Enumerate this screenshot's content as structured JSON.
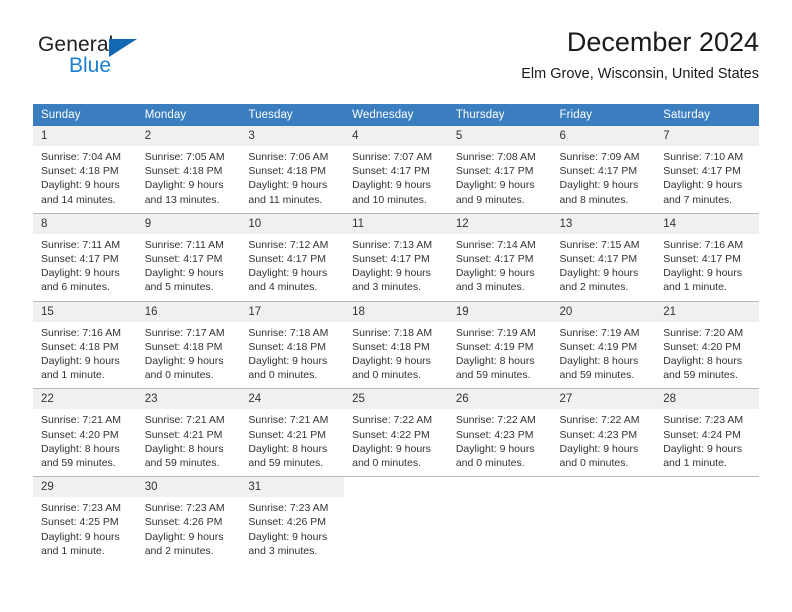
{
  "logo": {
    "text_primary": "General",
    "text_secondary": "Blue",
    "primary_color": "#231f20",
    "secondary_color": "#1a7fd4",
    "triangle_color": "#1268b3"
  },
  "header": {
    "title": "December 2024",
    "subtitle": "Elm Grove, Wisconsin, United States"
  },
  "theme": {
    "header_row_bg": "#3a7ec0",
    "header_row_text": "#ffffff",
    "daynum_bg": "#f0f0f0",
    "cell_border": "#b9b9b9"
  },
  "weekday_headers": [
    "Sunday",
    "Monday",
    "Tuesday",
    "Wednesday",
    "Thursday",
    "Friday",
    "Saturday"
  ],
  "weeks": [
    [
      {
        "day": "1",
        "sunrise": "Sunrise: 7:04 AM",
        "sunset": "Sunset: 4:18 PM",
        "daylight_line1": "Daylight: 9 hours",
        "daylight_line2": "and 14 minutes."
      },
      {
        "day": "2",
        "sunrise": "Sunrise: 7:05 AM",
        "sunset": "Sunset: 4:18 PM",
        "daylight_line1": "Daylight: 9 hours",
        "daylight_line2": "and 13 minutes."
      },
      {
        "day": "3",
        "sunrise": "Sunrise: 7:06 AM",
        "sunset": "Sunset: 4:18 PM",
        "daylight_line1": "Daylight: 9 hours",
        "daylight_line2": "and 11 minutes."
      },
      {
        "day": "4",
        "sunrise": "Sunrise: 7:07 AM",
        "sunset": "Sunset: 4:17 PM",
        "daylight_line1": "Daylight: 9 hours",
        "daylight_line2": "and 10 minutes."
      },
      {
        "day": "5",
        "sunrise": "Sunrise: 7:08 AM",
        "sunset": "Sunset: 4:17 PM",
        "daylight_line1": "Daylight: 9 hours",
        "daylight_line2": "and 9 minutes."
      },
      {
        "day": "6",
        "sunrise": "Sunrise: 7:09 AM",
        "sunset": "Sunset: 4:17 PM",
        "daylight_line1": "Daylight: 9 hours",
        "daylight_line2": "and 8 minutes."
      },
      {
        "day": "7",
        "sunrise": "Sunrise: 7:10 AM",
        "sunset": "Sunset: 4:17 PM",
        "daylight_line1": "Daylight: 9 hours",
        "daylight_line2": "and 7 minutes."
      }
    ],
    [
      {
        "day": "8",
        "sunrise": "Sunrise: 7:11 AM",
        "sunset": "Sunset: 4:17 PM",
        "daylight_line1": "Daylight: 9 hours",
        "daylight_line2": "and 6 minutes."
      },
      {
        "day": "9",
        "sunrise": "Sunrise: 7:11 AM",
        "sunset": "Sunset: 4:17 PM",
        "daylight_line1": "Daylight: 9 hours",
        "daylight_line2": "and 5 minutes."
      },
      {
        "day": "10",
        "sunrise": "Sunrise: 7:12 AM",
        "sunset": "Sunset: 4:17 PM",
        "daylight_line1": "Daylight: 9 hours",
        "daylight_line2": "and 4 minutes."
      },
      {
        "day": "11",
        "sunrise": "Sunrise: 7:13 AM",
        "sunset": "Sunset: 4:17 PM",
        "daylight_line1": "Daylight: 9 hours",
        "daylight_line2": "and 3 minutes."
      },
      {
        "day": "12",
        "sunrise": "Sunrise: 7:14 AM",
        "sunset": "Sunset: 4:17 PM",
        "daylight_line1": "Daylight: 9 hours",
        "daylight_line2": "and 3 minutes."
      },
      {
        "day": "13",
        "sunrise": "Sunrise: 7:15 AM",
        "sunset": "Sunset: 4:17 PM",
        "daylight_line1": "Daylight: 9 hours",
        "daylight_line2": "and 2 minutes."
      },
      {
        "day": "14",
        "sunrise": "Sunrise: 7:16 AM",
        "sunset": "Sunset: 4:17 PM",
        "daylight_line1": "Daylight: 9 hours",
        "daylight_line2": "and 1 minute."
      }
    ],
    [
      {
        "day": "15",
        "sunrise": "Sunrise: 7:16 AM",
        "sunset": "Sunset: 4:18 PM",
        "daylight_line1": "Daylight: 9 hours",
        "daylight_line2": "and 1 minute."
      },
      {
        "day": "16",
        "sunrise": "Sunrise: 7:17 AM",
        "sunset": "Sunset: 4:18 PM",
        "daylight_line1": "Daylight: 9 hours",
        "daylight_line2": "and 0 minutes."
      },
      {
        "day": "17",
        "sunrise": "Sunrise: 7:18 AM",
        "sunset": "Sunset: 4:18 PM",
        "daylight_line1": "Daylight: 9 hours",
        "daylight_line2": "and 0 minutes."
      },
      {
        "day": "18",
        "sunrise": "Sunrise: 7:18 AM",
        "sunset": "Sunset: 4:18 PM",
        "daylight_line1": "Daylight: 9 hours",
        "daylight_line2": "and 0 minutes."
      },
      {
        "day": "19",
        "sunrise": "Sunrise: 7:19 AM",
        "sunset": "Sunset: 4:19 PM",
        "daylight_line1": "Daylight: 8 hours",
        "daylight_line2": "and 59 minutes."
      },
      {
        "day": "20",
        "sunrise": "Sunrise: 7:19 AM",
        "sunset": "Sunset: 4:19 PM",
        "daylight_line1": "Daylight: 8 hours",
        "daylight_line2": "and 59 minutes."
      },
      {
        "day": "21",
        "sunrise": "Sunrise: 7:20 AM",
        "sunset": "Sunset: 4:20 PM",
        "daylight_line1": "Daylight: 8 hours",
        "daylight_line2": "and 59 minutes."
      }
    ],
    [
      {
        "day": "22",
        "sunrise": "Sunrise: 7:21 AM",
        "sunset": "Sunset: 4:20 PM",
        "daylight_line1": "Daylight: 8 hours",
        "daylight_line2": "and 59 minutes."
      },
      {
        "day": "23",
        "sunrise": "Sunrise: 7:21 AM",
        "sunset": "Sunset: 4:21 PM",
        "daylight_line1": "Daylight: 8 hours",
        "daylight_line2": "and 59 minutes."
      },
      {
        "day": "24",
        "sunrise": "Sunrise: 7:21 AM",
        "sunset": "Sunset: 4:21 PM",
        "daylight_line1": "Daylight: 8 hours",
        "daylight_line2": "and 59 minutes."
      },
      {
        "day": "25",
        "sunrise": "Sunrise: 7:22 AM",
        "sunset": "Sunset: 4:22 PM",
        "daylight_line1": "Daylight: 9 hours",
        "daylight_line2": "and 0 minutes."
      },
      {
        "day": "26",
        "sunrise": "Sunrise: 7:22 AM",
        "sunset": "Sunset: 4:23 PM",
        "daylight_line1": "Daylight: 9 hours",
        "daylight_line2": "and 0 minutes."
      },
      {
        "day": "27",
        "sunrise": "Sunrise: 7:22 AM",
        "sunset": "Sunset: 4:23 PM",
        "daylight_line1": "Daylight: 9 hours",
        "daylight_line2": "and 0 minutes."
      },
      {
        "day": "28",
        "sunrise": "Sunrise: 7:23 AM",
        "sunset": "Sunset: 4:24 PM",
        "daylight_line1": "Daylight: 9 hours",
        "daylight_line2": "and 1 minute."
      }
    ],
    [
      {
        "day": "29",
        "sunrise": "Sunrise: 7:23 AM",
        "sunset": "Sunset: 4:25 PM",
        "daylight_line1": "Daylight: 9 hours",
        "daylight_line2": "and 1 minute."
      },
      {
        "day": "30",
        "sunrise": "Sunrise: 7:23 AM",
        "sunset": "Sunset: 4:26 PM",
        "daylight_line1": "Daylight: 9 hours",
        "daylight_line2": "and 2 minutes."
      },
      {
        "day": "31",
        "sunrise": "Sunrise: 7:23 AM",
        "sunset": "Sunset: 4:26 PM",
        "daylight_line1": "Daylight: 9 hours",
        "daylight_line2": "and 3 minutes."
      },
      {
        "day": "",
        "sunrise": "",
        "sunset": "",
        "daylight_line1": "",
        "daylight_line2": ""
      },
      {
        "day": "",
        "sunrise": "",
        "sunset": "",
        "daylight_line1": "",
        "daylight_line2": ""
      },
      {
        "day": "",
        "sunrise": "",
        "sunset": "",
        "daylight_line1": "",
        "daylight_line2": ""
      },
      {
        "day": "",
        "sunrise": "",
        "sunset": "",
        "daylight_line1": "",
        "daylight_line2": ""
      }
    ]
  ]
}
